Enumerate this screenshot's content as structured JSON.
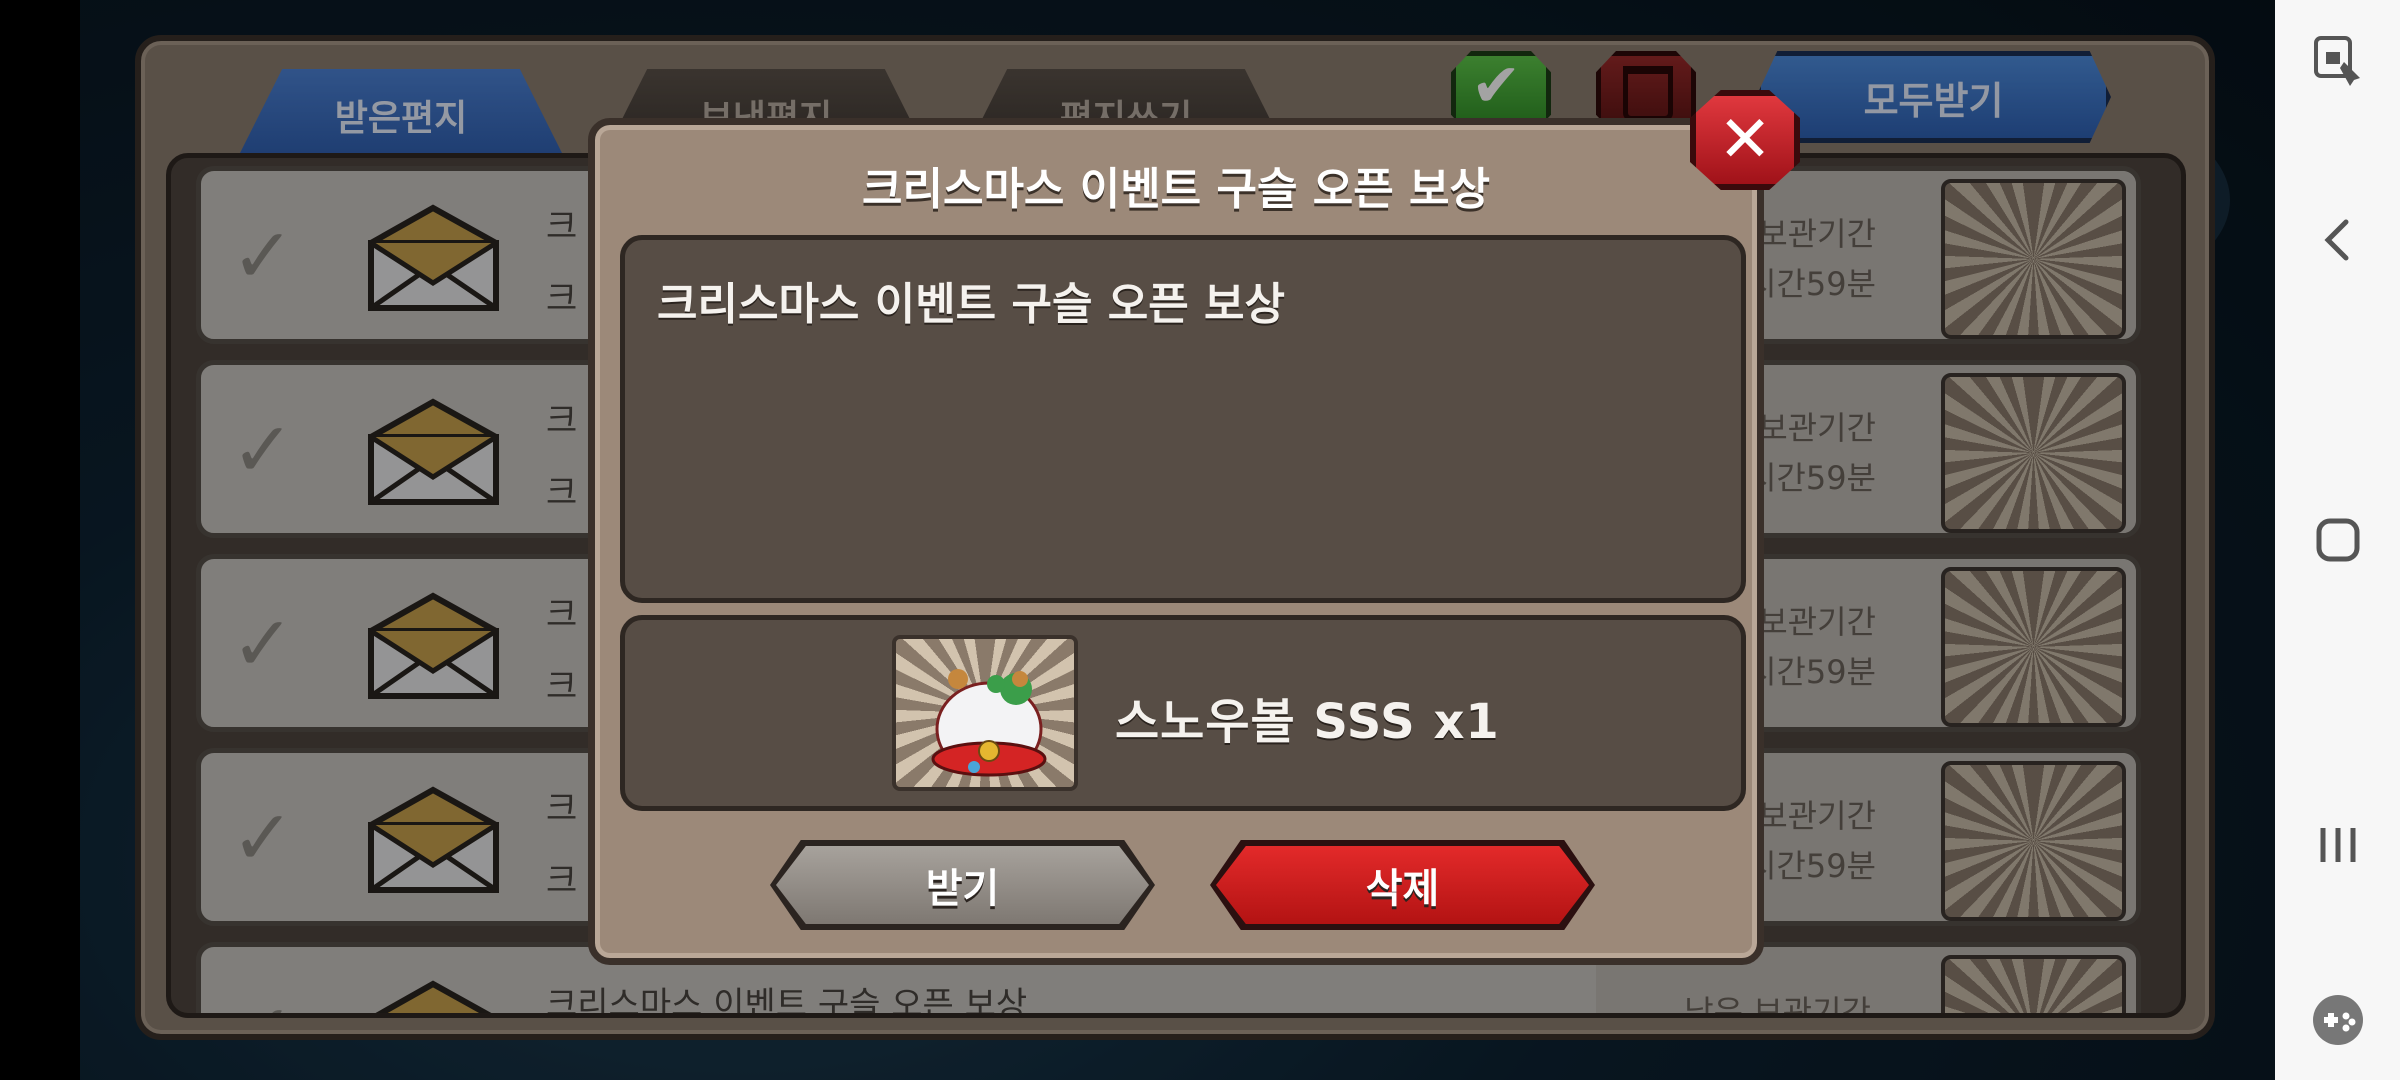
{
  "mailbox": {
    "tabs": [
      {
        "label": "받은편지"
      },
      {
        "label": "보낸편지"
      },
      {
        "label": "편지쓰기"
      }
    ],
    "receive_all_label": "모두받기",
    "rows": [
      {
        "title": "크",
        "subtitle": "크",
        "keep_label": "보관기간",
        "keep_time": "시간59분"
      },
      {
        "title": "크",
        "subtitle": "크",
        "keep_label": "보관기간",
        "keep_time": "시간59분"
      },
      {
        "title": "크",
        "subtitle": "크",
        "keep_label": "보관기간",
        "keep_time": "시간59분"
      },
      {
        "title": "크",
        "subtitle": "크",
        "keep_label": "보관기간",
        "keep_time": "시간59분"
      },
      {
        "title": "크리스마스 이벤트 구슬 오픈 보상",
        "subtitle": "",
        "keep_label": "남은 보관기간",
        "keep_time": ""
      }
    ]
  },
  "dialog": {
    "title": "크리스마스 이벤트 구슬 오픈 보상",
    "body": "크리스마스 이벤트 구슬 오픈 보상",
    "reward_label": "스노우볼 SSS x1",
    "receive_button": "받기",
    "delete_button": "삭제"
  },
  "colors": {
    "tab_active": "#3a6ec4",
    "delete_button": "#d11f1f",
    "close_button": "#c61d24"
  }
}
